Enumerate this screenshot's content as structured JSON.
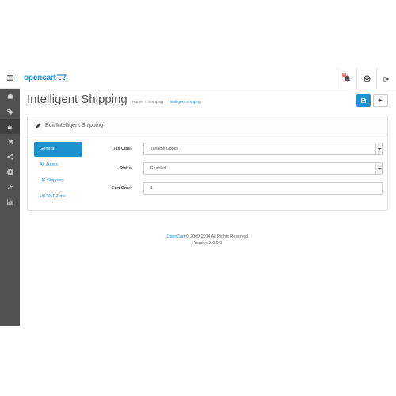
{
  "header": {
    "logo": "opencart",
    "notifications_count": "5"
  },
  "sidebar": {
    "icons": [
      "dashboard-icon",
      "tags-icon",
      "puzzle-icon",
      "cart-icon",
      "share-icon",
      "cog-icon",
      "wrench-icon",
      "chart-icon"
    ]
  },
  "page": {
    "title": "Intelligent Shipping",
    "breadcrumb": [
      "Home",
      "Shipping",
      "Intelligent Shipping"
    ]
  },
  "panel": {
    "title": "Edit Intelligent Shipping",
    "tabs": [
      "General",
      "All Zones",
      "UK Shipping",
      "UK VAT Zone"
    ],
    "fields": {
      "tax_class": {
        "label": "Tax Class",
        "value": "Taxable Goods"
      },
      "status": {
        "label": "Status",
        "value": "Enabled"
      },
      "sort_order": {
        "label": "Sort Order",
        "value": "1"
      }
    }
  },
  "footer": {
    "link": "OpenCart",
    "copyright": " © 2009-2014 All Rights Reserved.",
    "version": "Version 2.0.0.0"
  },
  "colors": {
    "accent": "#1e91cf",
    "sidebar": "#515151",
    "badge": "#f56b6b"
  }
}
